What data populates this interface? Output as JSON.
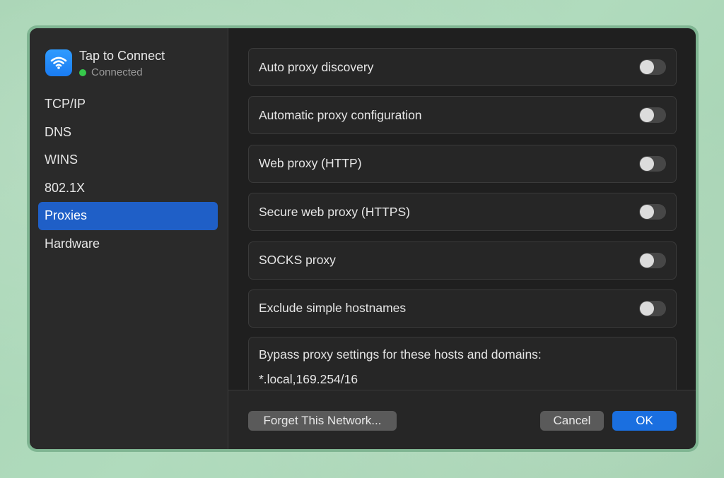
{
  "network": {
    "name": "Tap to Connect",
    "status": "Connected",
    "icon": "wifi-icon",
    "status_color": "#36c84b"
  },
  "sidebar": {
    "items": [
      {
        "label": "TCP/IP",
        "active": false
      },
      {
        "label": "DNS",
        "active": false
      },
      {
        "label": "WINS",
        "active": false
      },
      {
        "label": "802.1X",
        "active": false
      },
      {
        "label": "Proxies",
        "active": true
      },
      {
        "label": "Hardware",
        "active": false
      }
    ]
  },
  "proxies": {
    "rows": [
      {
        "label": "Auto proxy discovery",
        "enabled": false
      },
      {
        "label": "Automatic proxy configuration",
        "enabled": false
      },
      {
        "label": "Web proxy (HTTP)",
        "enabled": false
      },
      {
        "label": "Secure web proxy (HTTPS)",
        "enabled": false
      },
      {
        "label": "SOCKS proxy",
        "enabled": false
      },
      {
        "label": "Exclude simple hostnames",
        "enabled": false
      }
    ],
    "bypass_label": "Bypass proxy settings for these hosts and domains:",
    "bypass_value": "*.local,169.254/16"
  },
  "footer": {
    "forget_label": "Forget This Network...",
    "cancel_label": "Cancel",
    "ok_label": "OK"
  },
  "colors": {
    "accent": "#1a6fe0",
    "sidebar_active": "#1f5fc7",
    "background": "#a8d4b4"
  }
}
